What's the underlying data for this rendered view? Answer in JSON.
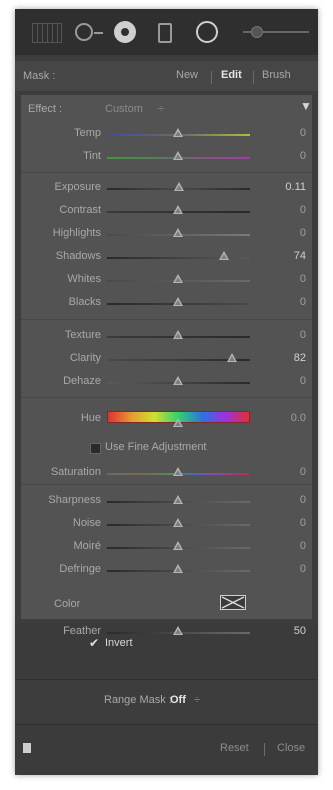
{
  "toolbar": {
    "tools": [
      "graduated-filter-icon",
      "spot-removal-icon",
      "radial-filter-icon",
      "rect-mask-icon",
      "brush-circle-icon",
      "tool-size-slider-icon"
    ]
  },
  "mask": {
    "label": "Mask :",
    "modes": [
      "New",
      "Edit",
      "Brush"
    ],
    "active_mode": "Edit"
  },
  "effect": {
    "label": "Effect :",
    "preset": "Custom",
    "preset_arrow": "÷",
    "collapse": "▼"
  },
  "adjustments": {
    "temp": {
      "label": "Temp",
      "value": "0",
      "pos": 0.5
    },
    "tint": {
      "label": "Tint",
      "value": "0",
      "pos": 0.5
    },
    "exposure": {
      "label": "Exposure",
      "value": "0.11",
      "pos": 0.505
    },
    "contrast": {
      "label": "Contrast",
      "value": "0",
      "pos": 0.5
    },
    "highlights": {
      "label": "Highlights",
      "value": "0",
      "pos": 0.5
    },
    "shadows": {
      "label": "Shadows",
      "value": "74",
      "pos": 0.87
    },
    "whites": {
      "label": "Whites",
      "value": "0",
      "pos": 0.5
    },
    "blacks": {
      "label": "Blacks",
      "value": "0",
      "pos": 0.5
    },
    "texture": {
      "label": "Texture",
      "value": "0",
      "pos": 0.5
    },
    "clarity": {
      "label": "Clarity",
      "value": "82",
      "pos": 0.91
    },
    "dehaze": {
      "label": "Dehaze",
      "value": "0",
      "pos": 0.5
    },
    "hue": {
      "label": "Hue",
      "value": "0.0",
      "pos": 0.5
    },
    "saturation": {
      "label": "Saturation",
      "value": "0",
      "pos": 0.5
    },
    "sharpness": {
      "label": "Sharpness",
      "value": "0",
      "pos": 0.5
    },
    "noise": {
      "label": "Noise",
      "value": "0",
      "pos": 0.5
    },
    "moire": {
      "label": "Moiré",
      "value": "0",
      "pos": 0.5
    },
    "defringe": {
      "label": "Defringe",
      "value": "0",
      "pos": 0.5
    }
  },
  "fine_adjustment": {
    "label": "Use Fine Adjustment",
    "checked": false
  },
  "color": {
    "label": "Color"
  },
  "feather": {
    "label": "Feather",
    "value": "50",
    "pos": 0.5
  },
  "invert": {
    "label": "Invert",
    "checked": true,
    "check_glyph": "✔"
  },
  "range_mask": {
    "label": "Range Mask :",
    "value": "Off",
    "arrow": "÷"
  },
  "footer": {
    "reset": "Reset",
    "close": "Close"
  },
  "colors": {
    "panel_bg": "#3d3d3d",
    "section_bg": "#535353",
    "toolbar_bg": "#2f2f2f",
    "text": "#a9a9a9",
    "active_mode": "#e6e6e6"
  }
}
